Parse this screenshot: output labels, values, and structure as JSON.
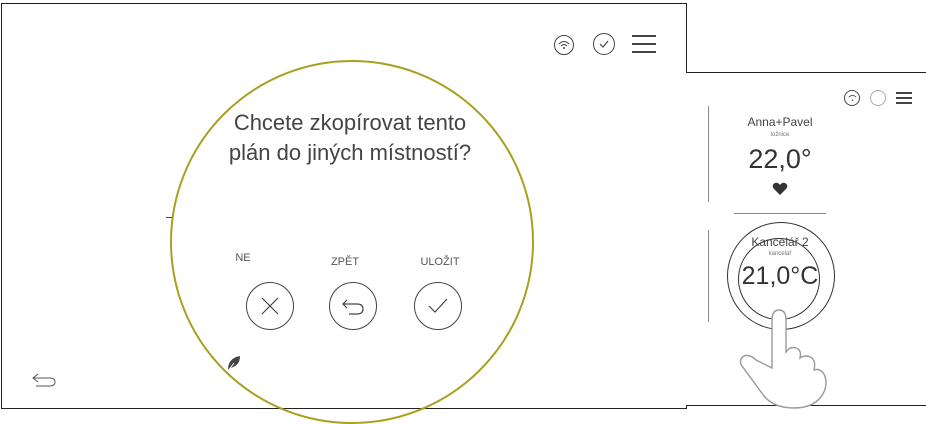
{
  "main": {
    "dialog": {
      "question_line1": "Chcete zkopírovat tento",
      "question_line2": "plán do jiných místností?",
      "actions": [
        {
          "label": "NE",
          "icon": "close-icon"
        },
        {
          "label": "ZPĚT",
          "icon": "undo-icon"
        },
        {
          "label": "ULOŽIT",
          "icon": "check-icon"
        }
      ]
    },
    "header_icons": [
      "wifi-icon",
      "chat-check-icon",
      "menu-icon"
    ],
    "footer_icons": [
      "back-arrow-icon",
      "leaf-icon"
    ]
  },
  "side": {
    "rooms": [
      {
        "name": "Anna+Pavel",
        "sub": "ložnice",
        "temp": "22,0°",
        "icon": "heart-icon"
      },
      {
        "name": "Kancelář 2",
        "sub": "kancelář",
        "temp": "21,0°C"
      }
    ],
    "header_icons": [
      "wifi-icon",
      "chat-check-icon",
      "menu-icon"
    ]
  },
  "colors": {
    "accent": "#a9a020",
    "line": "#333333"
  }
}
